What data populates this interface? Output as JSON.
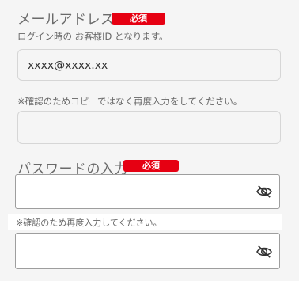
{
  "email_section": {
    "title": "メールアドレス",
    "required_badge": "必須",
    "hint": "ログイン時の お客様ID となります。",
    "value": "xxxx@xxxx.xx",
    "confirm_note": "※確認のためコピーではなく再度入力をしてください。",
    "confirm_value": ""
  },
  "password_section": {
    "title": "パスワードの入力",
    "required_badge": "必須",
    "confirm_note": "※確認のため再度入力してください。",
    "toggle_icon": "eye-slash-icon"
  },
  "colors": {
    "required_badge": "#e60012",
    "background": "#f5f5f5"
  }
}
